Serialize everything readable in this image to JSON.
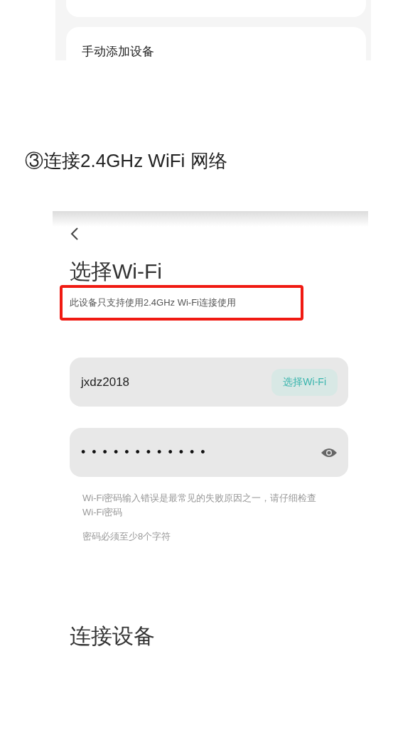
{
  "top_panel": {
    "item": "手动添加设备"
  },
  "step_heading": "③连接2.4GHz WiFi 网络",
  "screen": {
    "title": "选择Wi-Fi",
    "subtitle": "此设备只支持使用2.4GHz Wi-Fi连接使用",
    "highlighted": true,
    "ssid_field": {
      "value": "jxdz2018",
      "button": "选择Wi-Fi"
    },
    "password_field": {
      "masked_value": "••••••••••••"
    },
    "hints": [
      "Wi-Fi密码输入错误是最常见的失败原因之一，请仔细检查Wi-Fi密码",
      "密码必须至少8个字符"
    ],
    "section_title": "连接设备"
  }
}
